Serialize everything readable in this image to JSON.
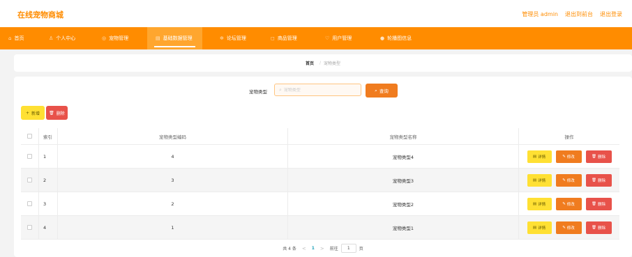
{
  "app": {
    "title": "在线宠物商城"
  },
  "header_right": {
    "admin": "管理员 admin",
    "back_to_front": "退出到前台",
    "logout": "退出登录"
  },
  "nav": [
    {
      "label": "首页",
      "icon": "⌂"
    },
    {
      "label": "个人中心",
      "icon": "♙"
    },
    {
      "label": "宠物管理",
      "icon": "◎"
    },
    {
      "label": "基础数据管理",
      "icon": "▤"
    },
    {
      "label": "论坛管理",
      "icon": "✲"
    },
    {
      "label": "商品管理",
      "icon": "◻"
    },
    {
      "label": "用户管理",
      "icon": "♡"
    },
    {
      "label": "轮播图信息",
      "icon": "●"
    }
  ],
  "breadcrumb": {
    "home": "首页",
    "separator": "/",
    "current": "宠物类型"
  },
  "search": {
    "label": "宠物类型",
    "placeholder": "宠物类型",
    "value": "",
    "button": "查询"
  },
  "actions": {
    "add": "新增",
    "delete": "删除"
  },
  "table": {
    "columns": [
      "索引",
      "宠物类型编码",
      "宠物类型名称",
      "操作"
    ],
    "rows": [
      {
        "index": "1",
        "code": "4",
        "name": "宠物类型4"
      },
      {
        "index": "2",
        "code": "3",
        "name": "宠物类型3"
      },
      {
        "index": "3",
        "code": "2",
        "name": "宠物类型2"
      },
      {
        "index": "4",
        "code": "1",
        "name": "宠物类型1"
      }
    ],
    "row_ops": {
      "detail": "详情",
      "edit": "修改",
      "delete": "删除"
    }
  },
  "pagination": {
    "total": "共 4 条",
    "prev": "<",
    "current_page": "1",
    "next": ">",
    "goto_label": "前往",
    "goto_value": "1",
    "page_suffix": "页"
  },
  "colors": {
    "accent": "#ff8c00",
    "add_button": "#ffe033",
    "edit_button": "#f07c1f",
    "delete_button": "#e8524a",
    "page_link": "#1ba1b8"
  }
}
